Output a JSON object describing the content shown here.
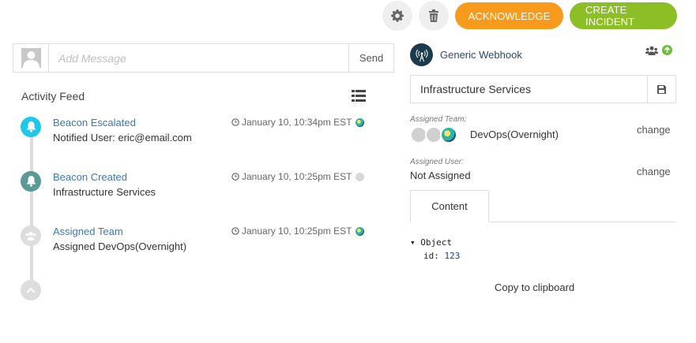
{
  "toolbar": {
    "settings_icon": "gear-icon",
    "delete_icon": "trash-icon",
    "acknowledge_label": "ACKNOWLEDGE",
    "create_incident_label": "CREATE INCIDENT",
    "colors": {
      "acknowledge": "#f89a1c",
      "create_incident": "#8cbf26"
    }
  },
  "message": {
    "placeholder": "Add Message",
    "send_label": "Send"
  },
  "feed": {
    "title": "Activity Feed",
    "items": [
      {
        "title": "Beacon Escalated",
        "subtitle": "Notified User: eric@email.com",
        "time": "January 10, 10:34pm EST",
        "dot_color": "#1ec8e8",
        "icon": "bell-icon"
      },
      {
        "title": "Beacon Created",
        "subtitle": "Infrastructure Services",
        "time": "January 10, 10:25pm EST",
        "dot_color": "#5a9a96",
        "icon": "bell-icon"
      },
      {
        "title": "Assigned Team",
        "subtitle": "Assigned DevOps(Overnight)",
        "time": "January 10, 10:25pm EST",
        "dot_color": "#dddddd",
        "icon": "users-icon"
      }
    ]
  },
  "detail": {
    "source_name": "Generic Webhook",
    "service": "Infrastructure Services",
    "assigned_team_label": "Assigned Team:",
    "assigned_team": "DevOps(Overnight)",
    "assigned_user_label": "Assigned User:",
    "assigned_user": "Not Assigned",
    "change_label": "change",
    "tab_label": "Content",
    "code_object": "Object",
    "code_key": "id:",
    "code_value": "123",
    "copy_label": "Copy to clipboard"
  }
}
